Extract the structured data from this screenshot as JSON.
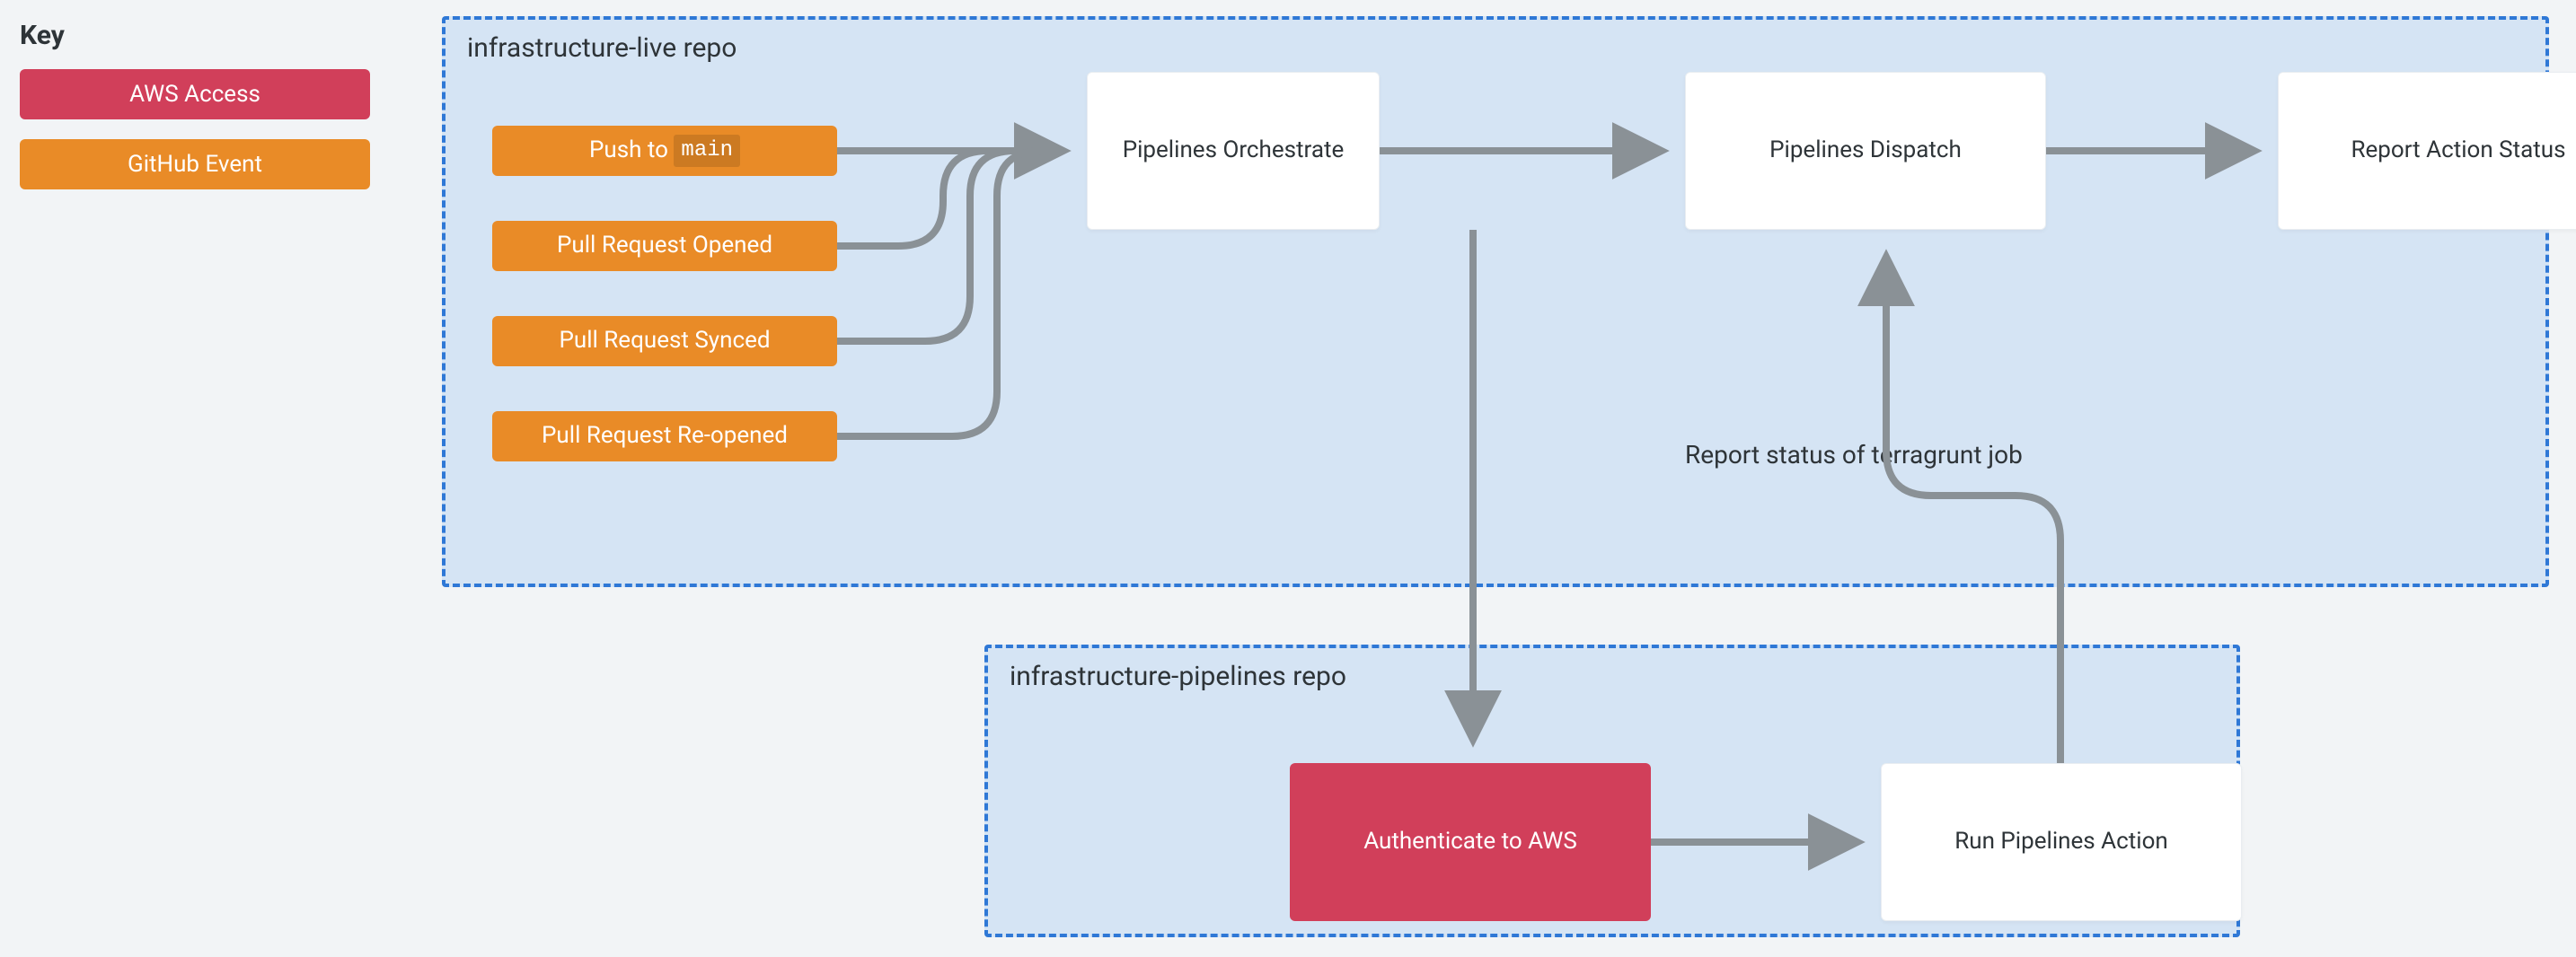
{
  "key": {
    "title": "Key",
    "aws": "AWS Access",
    "github": "GitHub Event"
  },
  "repos": {
    "live": "infrastructure-live repo",
    "pipelines": "infrastructure-pipelines repo"
  },
  "events": {
    "push_prefix": "Push to ",
    "push_code": "main",
    "pr_opened": "Pull Request Opened",
    "pr_synced": "Pull Request Synced",
    "pr_reopened": "Pull Request Re-opened"
  },
  "nodes": {
    "orchestrate": "Pipelines Orchestrate",
    "dispatch": "Pipelines Dispatch",
    "report_action": "Report Action Status",
    "auth": "Authenticate to AWS",
    "run": "Run Pipelines Action"
  },
  "annotations": {
    "report_status": "Report status of terragrunt job"
  },
  "colors": {
    "aws": "#d13f5a",
    "github": "#e98b27",
    "border": "#2f78d6",
    "container_bg": "#d5e4f4",
    "arrow": "#8a9196"
  }
}
